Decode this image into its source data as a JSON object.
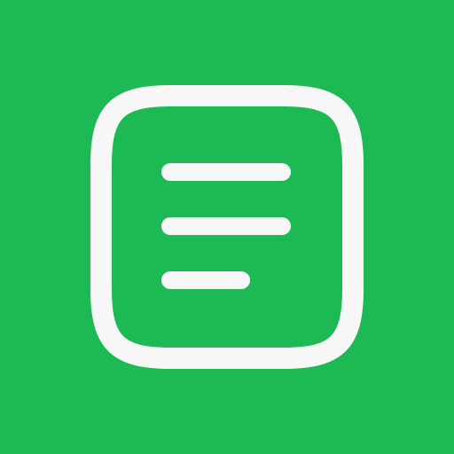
{
  "app_icon": {
    "icon": "document-lines-icon",
    "colors": {
      "background": "#1DB954",
      "stroke": "#F7F7F7"
    }
  }
}
